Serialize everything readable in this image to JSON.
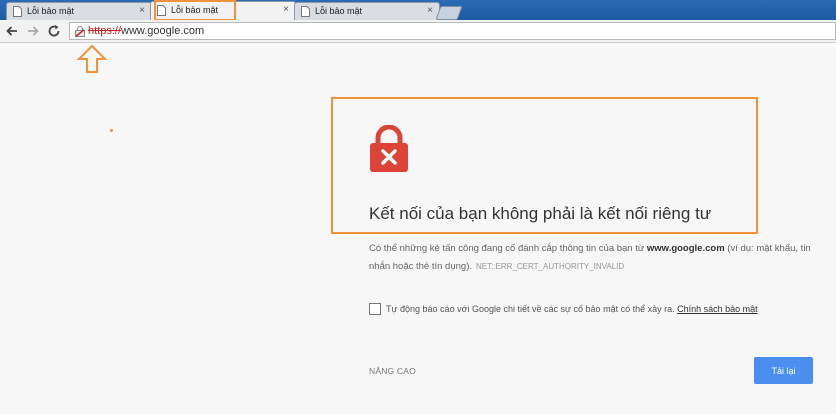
{
  "tabs": [
    {
      "title": "Lỗi bảo mật",
      "close": "×"
    },
    {
      "title": "Lỗi bảo mật",
      "close": "×"
    },
    {
      "title": "Lỗi bảo mật",
      "close": "×"
    }
  ],
  "toolbar": {
    "url_scheme": "https://",
    "url_host": "www.google.com"
  },
  "page": {
    "heading": "Kết nối của bạn không phải là kết nối riêng tư",
    "para_prefix": "Có thể những kẻ tấn công đang cố đánh cắp thông tin của bạn từ ",
    "para_host": "www.google.com",
    "para_suffix": " (ví dụ: mật khẩu, tin nhắn hoặc thẻ tín dụng).",
    "error_code": "NET::ERR_CERT_AUTHORITY_INVALID",
    "report_text": "Tự động báo cáo với Google chi tiết về các sự cố bảo mật có thể xảy ra.",
    "report_link": "Chính sách bảo mật",
    "advanced_label": "NÂNG CAO",
    "reload_label": "Tải lại"
  },
  "colors": {
    "annotation": "#f0923b",
    "lock_red": "#db4437",
    "button_blue": "#4a8ff0",
    "tabstrip_blue": "#1f5da8"
  },
  "icons": [
    "page-icon",
    "back-arrow-icon",
    "forward-arrow-icon",
    "reload-icon",
    "broken-lock-icon",
    "up-arrow-icon",
    "padlock-error-icon"
  ]
}
